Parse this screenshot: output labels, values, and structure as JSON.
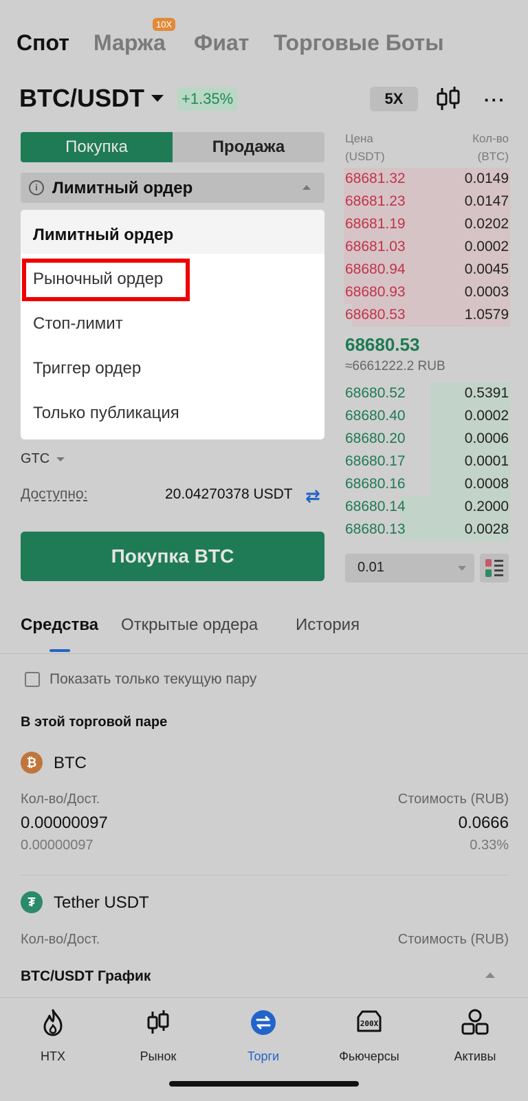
{
  "top_tabs": {
    "spot": "Спот",
    "margin": "Маржа",
    "margin_badge": "10X",
    "fiat": "Фиат",
    "bots": "Торговые Боты"
  },
  "pair": {
    "name": "BTC/USDT",
    "change": "+1.35%",
    "leverage": "5X",
    "more": "···"
  },
  "trade": {
    "buy_tab": "Покупка",
    "sell_tab": "Продажа",
    "order_type": "Лимитный ордер",
    "info": "i"
  },
  "dropdown": {
    "items": [
      "Лимитный ордер",
      "Рыночный ордер",
      "Стоп-лимит",
      "Триггер ордер",
      "Только публикация"
    ]
  },
  "form": {
    "tif": "GTC",
    "available_label": "Доступно:",
    "available_value": "20.04270378 USDT",
    "buy_button": "Покупка  BTC"
  },
  "orderbook": {
    "price_header": "Цена",
    "price_unit": "(USDT)",
    "qty_header": "Кол-во",
    "qty_unit": "(BTC)",
    "asks": [
      {
        "price": "68681.32",
        "qty": "0.0149",
        "depth": 1.0
      },
      {
        "price": "68681.23",
        "qty": "0.0147",
        "depth": 1.0
      },
      {
        "price": "68681.19",
        "qty": "0.0202",
        "depth": 1.0
      },
      {
        "price": "68681.03",
        "qty": "0.0002",
        "depth": 1.0
      },
      {
        "price": "68680.94",
        "qty": "0.0045",
        "depth": 1.0
      },
      {
        "price": "68680.93",
        "qty": "0.0003",
        "depth": 1.0
      },
      {
        "price": "68680.53",
        "qty": "1.0579",
        "depth": 0.95
      }
    ],
    "mid_price": "68680.53",
    "mid_rub": "≈6661222.2 RUB",
    "bids": [
      {
        "price": "68680.52",
        "qty": "0.5391",
        "depth": 0.48
      },
      {
        "price": "68680.40",
        "qty": "0.0002",
        "depth": 0.48
      },
      {
        "price": "68680.20",
        "qty": "0.0006",
        "depth": 0.48
      },
      {
        "price": "68680.17",
        "qty": "0.0001",
        "depth": 0.48
      },
      {
        "price": "68680.16",
        "qty": "0.0008",
        "depth": 0.48
      },
      {
        "price": "68680.14",
        "qty": "0.2000",
        "depth": 0.66
      },
      {
        "price": "68680.13",
        "qty": "0.0028",
        "depth": 0.66
      }
    ],
    "precision": "0.01"
  },
  "lower_tabs": {
    "funds": "Средства",
    "open_orders": "Открытые ордера",
    "history": "История"
  },
  "assets": {
    "filter_label": "Показать только текущую пару",
    "section_title": "В этой торговой паре",
    "btc": {
      "icon": "₿",
      "name": "BTC",
      "qty_label": "Кол-во/Дост.",
      "value_label": "Стоимость (RUB)",
      "qty": "0.00000097",
      "value": "0.0666",
      "avail": "0.00000097",
      "pct": "0.33%"
    },
    "usdt": {
      "icon": "₮",
      "name": "Tether USDT",
      "qty_label": "Кол-во/Дост.",
      "value_label": "Стоимость (RUB)"
    }
  },
  "chart_bar": {
    "label": "BTC/USDT График"
  },
  "nav": {
    "htx": "HTX",
    "market": "Рынок",
    "trade": "Торги",
    "futures": "Фьючерсы",
    "assets": "Активы",
    "futures_badge": "200X"
  },
  "colors": {
    "buy": "#1f7b55",
    "sell": "#c0334a",
    "accent": "#2264c9",
    "highlight": "#ee0000"
  }
}
